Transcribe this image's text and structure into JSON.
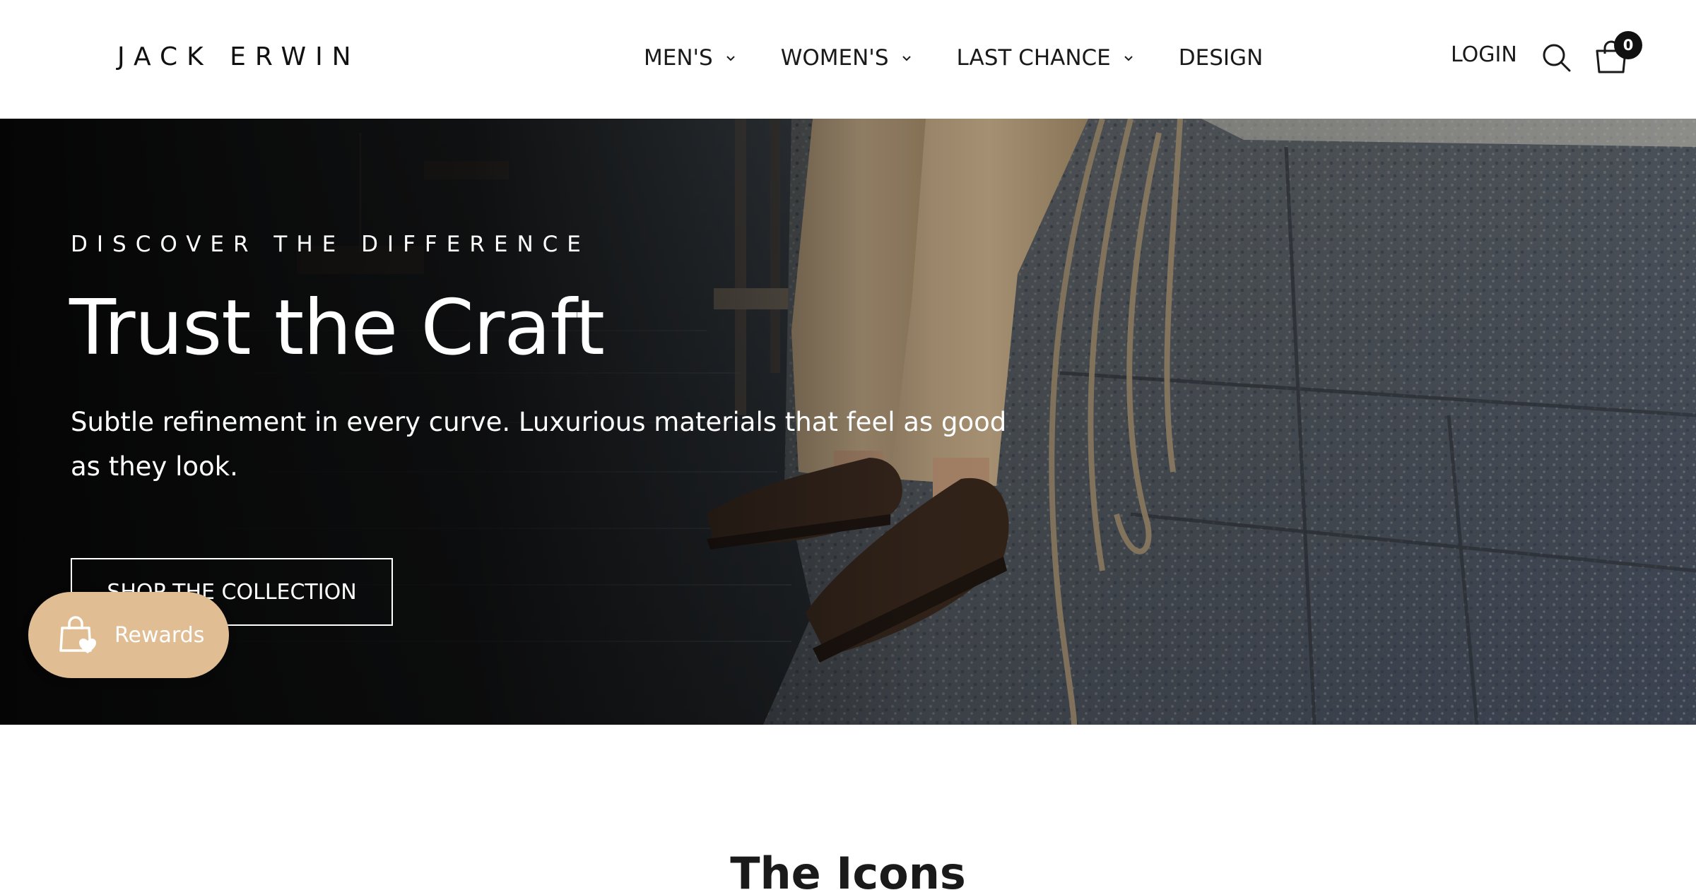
{
  "header": {
    "logo": "JACK ERWIN",
    "nav": [
      {
        "label": "MEN'S",
        "has_dropdown": true
      },
      {
        "label": "WOMEN'S",
        "has_dropdown": true
      },
      {
        "label": "LAST CHANCE",
        "has_dropdown": true
      },
      {
        "label": "DESIGN",
        "has_dropdown": false
      }
    ],
    "login_label": "LOGIN",
    "cart_count": "0",
    "icons": [
      "search-icon",
      "cart-icon",
      "chevron-down-icon"
    ]
  },
  "hero": {
    "eyebrow": "DISCOVER THE DIFFERENCE",
    "title": "Trust the Craft",
    "subtitle": "Subtle refinement in every curve. Luxurious materials that feel as good as they look.",
    "cta_label": "SHOP THE COLLECTION"
  },
  "rewards": {
    "label": "Rewards",
    "icon": "shopping-bag-heart-icon",
    "color": "#e1bd93"
  },
  "section": {
    "title": "The Icons"
  },
  "colors": {
    "text": "#1a1a1a",
    "header_bg": "#ffffff",
    "hero_text": "#ffffff",
    "badge_bg": "#111111"
  }
}
